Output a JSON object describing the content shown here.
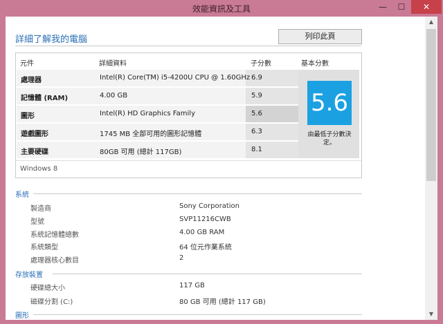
{
  "window": {
    "title": "效能資訊及工具",
    "minimize_glyph": "—",
    "maximize_glyph": "☐",
    "close_glyph": "✕"
  },
  "header": {
    "title": "詳細了解我的電腦",
    "print_label": "列印此頁"
  },
  "score_table": {
    "headers": {
      "component": "元件",
      "details": "詳細資料",
      "subscore": "子分數",
      "base": "基本分數"
    },
    "rows": [
      {
        "component": "處理器",
        "details": "Intel(R) Core(TM) i5-4200U CPU @ 1.60GHz",
        "subscore": "6.9"
      },
      {
        "component": "記憶體 (RAM)",
        "details": "4.00 GB",
        "subscore": "5.9"
      },
      {
        "component": "圖形",
        "details": "Intel(R) HD Graphics Family",
        "subscore": "5.6"
      },
      {
        "component": "遊戲圖形",
        "details": "1745 MB 全部可用的圖形記憶體",
        "subscore": "6.3"
      },
      {
        "component": "主要硬碟",
        "details": "80GB 可用 (總計 117GB)",
        "subscore": "8.1"
      }
    ],
    "base_score": "5.6",
    "base_desc": "由最低子分數決定。",
    "os": "Windows 8"
  },
  "system": {
    "heading": "系統",
    "items": [
      {
        "label": "製造商",
        "value": "Sony Corporation"
      },
      {
        "label": "型號",
        "value": "SVP11216CWB"
      },
      {
        "label": "系統記憶體總數",
        "value": "4.00 GB RAM"
      },
      {
        "label": "系統類型",
        "value": "64 位元作業系統"
      },
      {
        "label": "處理器核心數目",
        "value": "2"
      }
    ]
  },
  "storage": {
    "heading": "存放裝置",
    "items": [
      {
        "label": "硬碟總大小",
        "value": "117 GB"
      },
      {
        "label": "磁碟分割 (C:)",
        "value": "80 GB 可用 (總計 117 GB)"
      }
    ]
  },
  "graphics": {
    "heading": "圖形"
  },
  "colors": {
    "titlebar": "#c97a94",
    "close": "#c7414b",
    "accent": "#2a6fb5",
    "score_tile": "#1ba1e2"
  }
}
